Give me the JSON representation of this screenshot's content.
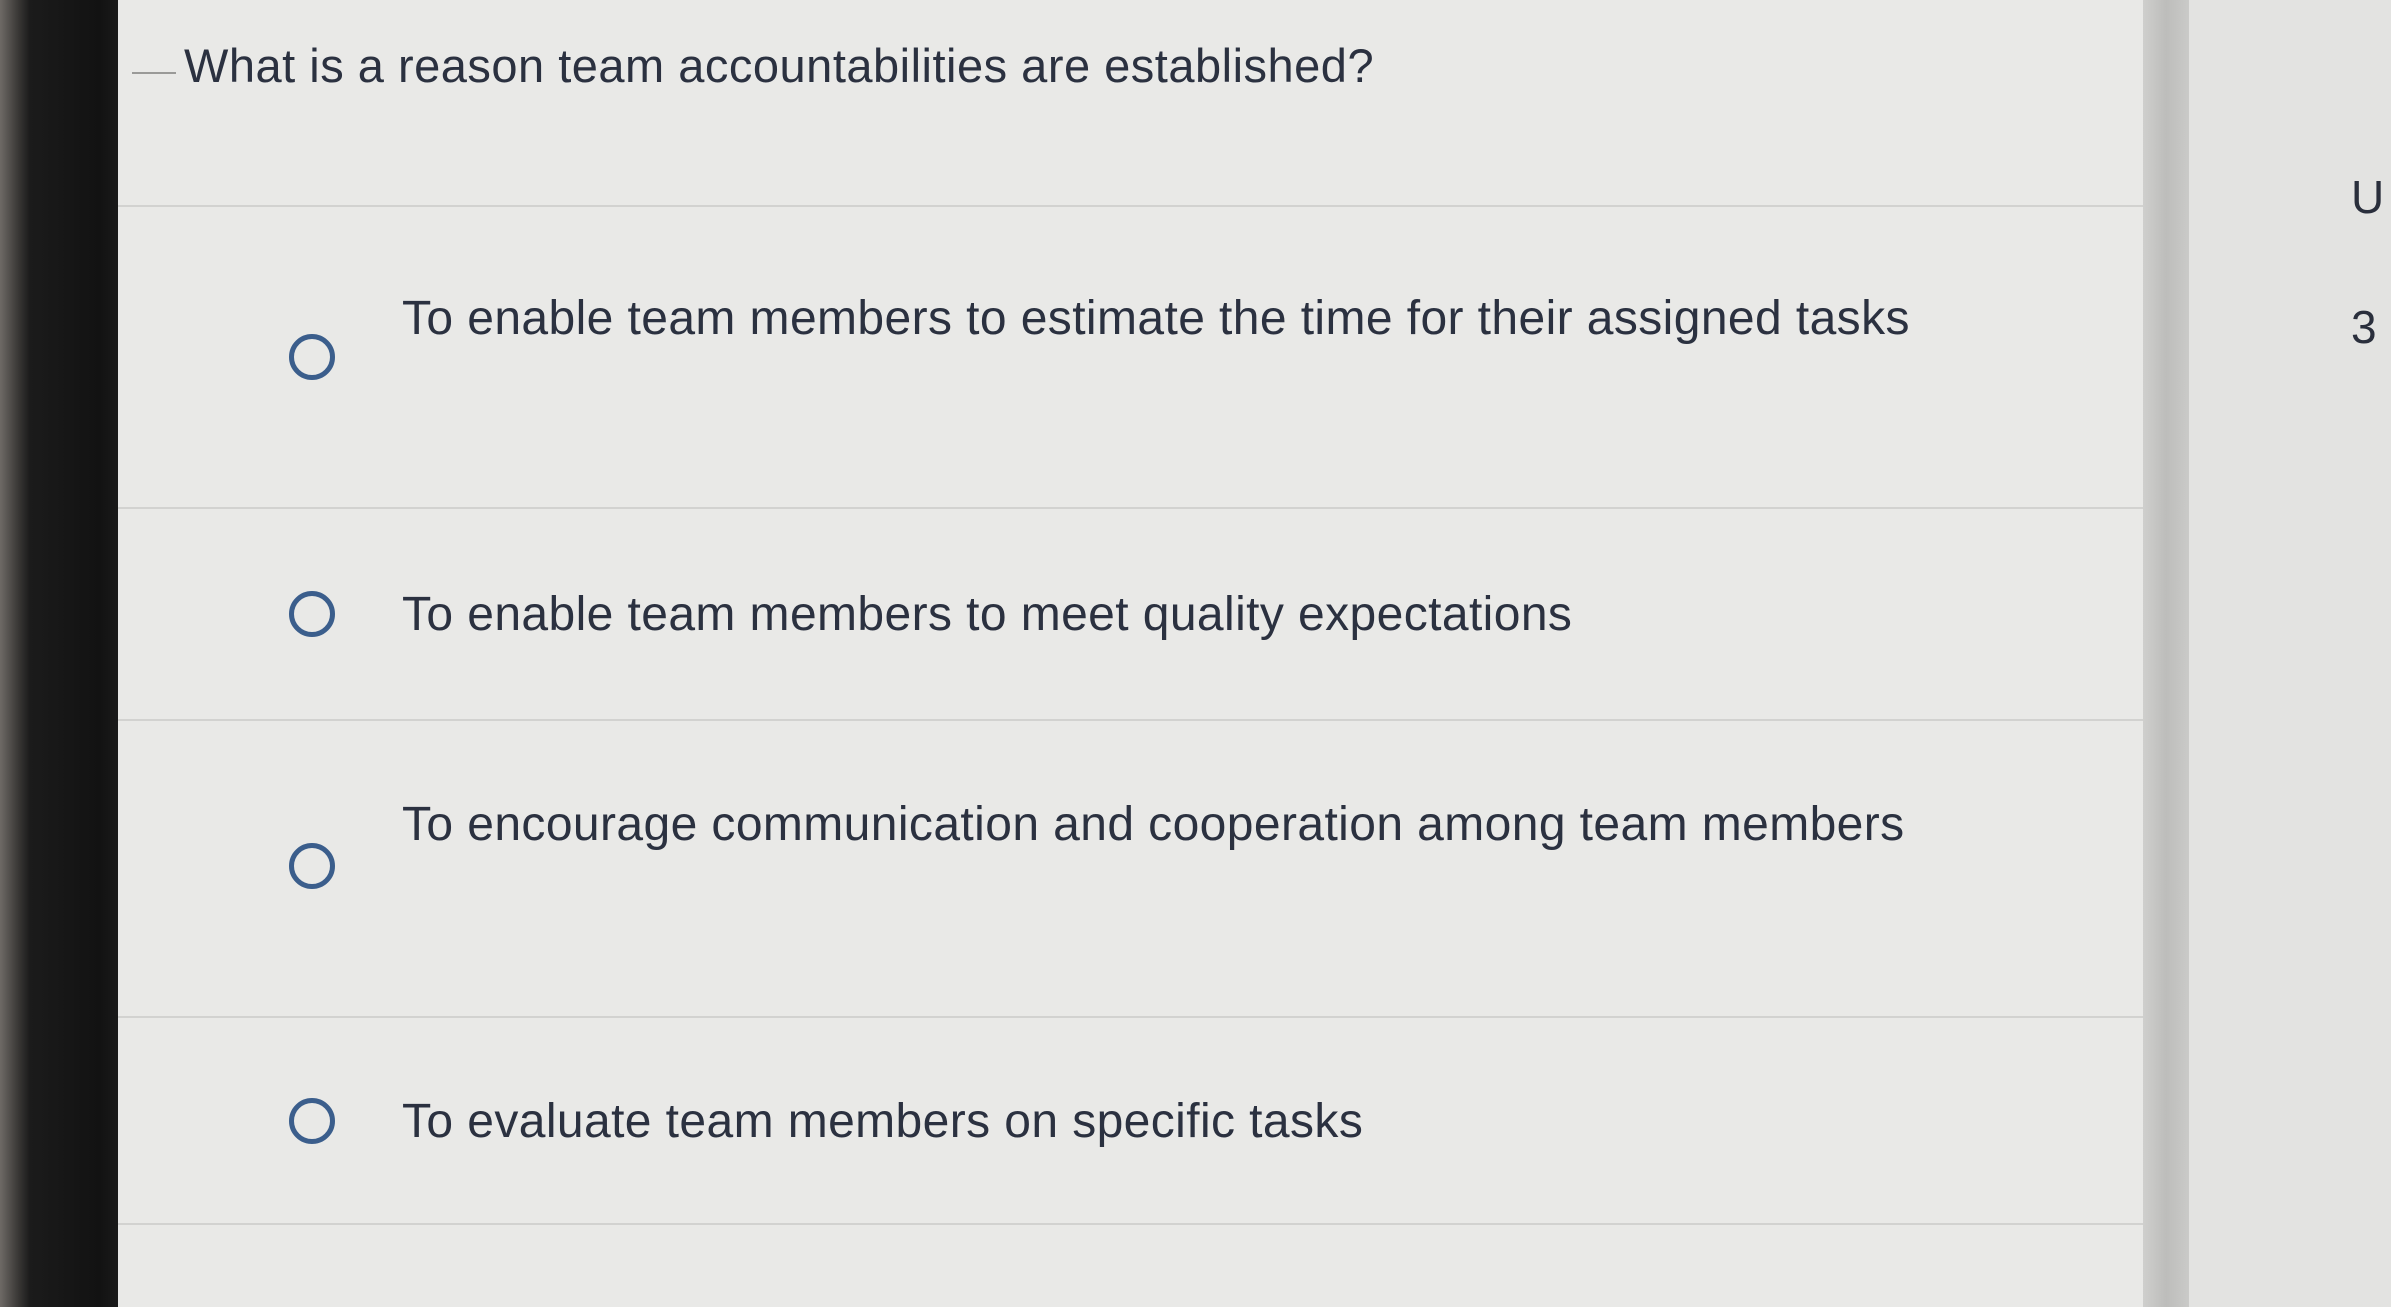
{
  "question": {
    "text": "What is a reason team accountabilities are established?"
  },
  "answers": [
    {
      "label": "To enable team members to estimate the time for their assigned tasks",
      "selected": false
    },
    {
      "label": "To enable team members to meet quality expectations",
      "selected": false
    },
    {
      "label": "To encourage communication and cooperation among team members",
      "selected": false
    },
    {
      "label": "To evaluate team members on specific tasks",
      "selected": false
    }
  ],
  "side_panel": {
    "char_1": "U",
    "char_2": "3"
  },
  "colors": {
    "radio_border": "#3b5e8c",
    "text": "#2b3140",
    "panel_bg": "#e9e9e7"
  }
}
